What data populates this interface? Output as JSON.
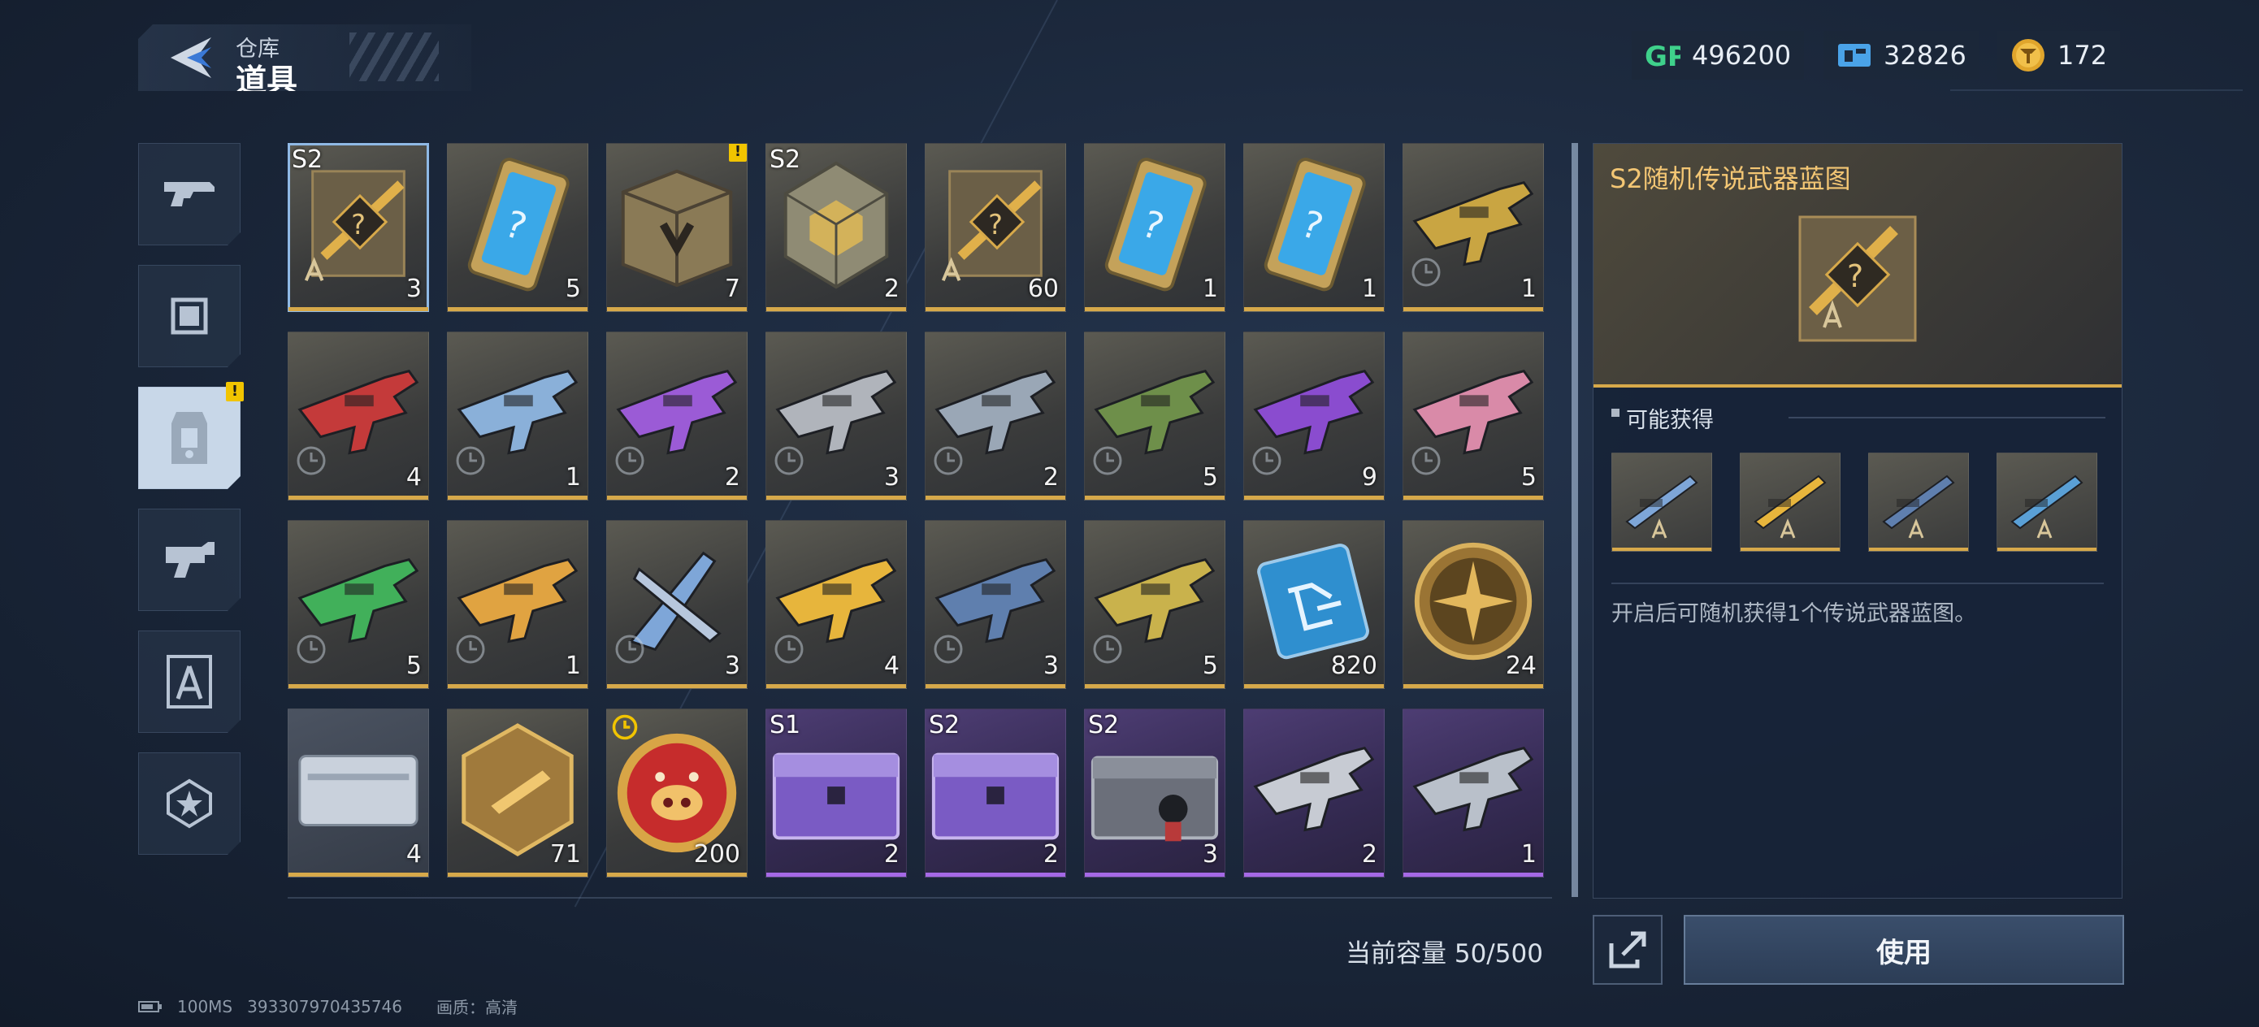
{
  "header": {
    "crumb_top": "仓库",
    "title": "道具"
  },
  "currencies": [
    {
      "icon": "gp-icon",
      "value": "496200"
    },
    {
      "icon": "ticket-icon",
      "value": "32826"
    },
    {
      "icon": "gold-coin-icon",
      "value": "172"
    }
  ],
  "sidebar": [
    {
      "icon": "weapon-icon"
    },
    {
      "icon": "skin-frame-icon"
    },
    {
      "icon": "items-icon",
      "active": true,
      "badge": "!"
    },
    {
      "icon": "gear-parts-icon"
    },
    {
      "icon": "blueprint-icon"
    },
    {
      "icon": "star-emblem-icon"
    }
  ],
  "grid": {
    "items": [
      {
        "season": "S2",
        "count": "3",
        "kind": "blueprint",
        "selected": true
      },
      {
        "count": "5",
        "kind": "card"
      },
      {
        "count": "7",
        "kind": "chest",
        "badge": "!"
      },
      {
        "season": "S2",
        "count": "2",
        "kind": "cube"
      },
      {
        "count": "60",
        "kind": "blueprint"
      },
      {
        "count": "1",
        "kind": "card"
      },
      {
        "count": "1",
        "kind": "card"
      },
      {
        "count": "1",
        "kind": "gun",
        "color": "#c9a542",
        "timed": true
      },
      {
        "count": "4",
        "kind": "gun",
        "color": "#c43a3a",
        "timed": true
      },
      {
        "count": "1",
        "kind": "gun",
        "color": "#8ab0d9",
        "timed": true
      },
      {
        "count": "2",
        "kind": "gun",
        "color": "#9b5bd6",
        "timed": true
      },
      {
        "count": "3",
        "kind": "gun",
        "color": "#b0b4bb",
        "timed": true
      },
      {
        "count": "2",
        "kind": "gun",
        "color": "#9aa7b6",
        "timed": true
      },
      {
        "count": "5",
        "kind": "gun",
        "color": "#6e8f4a",
        "timed": true
      },
      {
        "count": "9",
        "kind": "gun",
        "color": "#8a4ccf",
        "timed": true
      },
      {
        "count": "5",
        "kind": "gun",
        "color": "#d98aa8",
        "timed": true
      },
      {
        "count": "5",
        "kind": "gun",
        "color": "#41b05a",
        "timed": true
      },
      {
        "count": "1",
        "kind": "gun",
        "color": "#e0a341",
        "timed": true
      },
      {
        "count": "3",
        "kind": "knife",
        "color": "#7ea6d8",
        "timed": true
      },
      {
        "count": "4",
        "kind": "gun",
        "color": "#e7b53c",
        "timed": true
      },
      {
        "count": "3",
        "kind": "gun",
        "color": "#5f7fae",
        "timed": true
      },
      {
        "count": "5",
        "kind": "gun",
        "color": "#c9b24c",
        "timed": true
      },
      {
        "count": "820",
        "kind": "chip"
      },
      {
        "count": "24",
        "kind": "medal"
      },
      {
        "count": "4",
        "kind": "case",
        "tone": "gray"
      },
      {
        "count": "71",
        "kind": "badge"
      },
      {
        "count": "200",
        "kind": "pig",
        "timed_top": true
      },
      {
        "season": "S1",
        "count": "2",
        "kind": "crate",
        "tone": "purple"
      },
      {
        "season": "S2",
        "count": "2",
        "kind": "crate",
        "tone": "purple"
      },
      {
        "season": "S2",
        "count": "3",
        "kind": "crate2",
        "tone": "purple"
      },
      {
        "count": "2",
        "kind": "gun",
        "color": "#c7cbd3",
        "tone": "purple"
      },
      {
        "count": "1",
        "kind": "gun",
        "color": "#b9c0ca",
        "tone": "purple"
      }
    ]
  },
  "capacity": "当前容量 50/500",
  "detail": {
    "title": "S2随机传说武器蓝图",
    "possible_label": "可能获得",
    "rewards": [
      {
        "icon": "knife-blueprint-icon",
        "color": "#7ea6d8"
      },
      {
        "icon": "rifle-blueprint-icon",
        "color": "#e7b53c"
      },
      {
        "icon": "sniper-blueprint-icon",
        "color": "#5f7fae"
      },
      {
        "icon": "pistol-blueprint-icon",
        "color": "#5aa0d6"
      }
    ],
    "description": "开启后可随机获得1个传说武器蓝图。"
  },
  "actions": {
    "use_label": "使用"
  },
  "footer": {
    "ping": "100MS",
    "id": "393307970435746",
    "quality": "画质：高清"
  },
  "colors": {
    "gold": "#d7a94a",
    "purple": "#a569e6",
    "accent_title": "#f3c674"
  }
}
